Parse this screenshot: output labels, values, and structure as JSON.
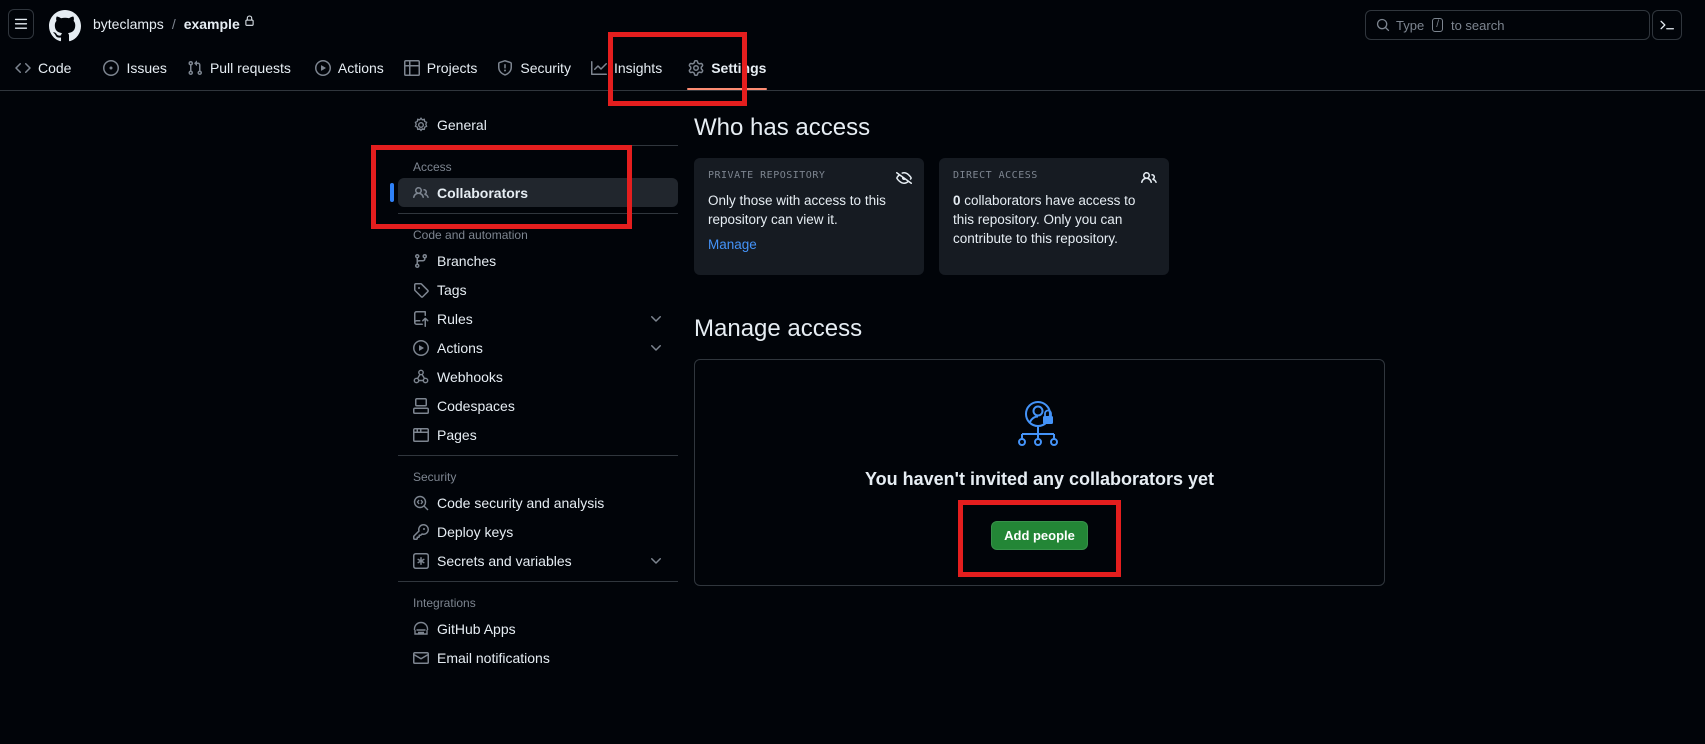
{
  "header": {
    "owner": "byteclamps",
    "separator": "/",
    "repo": "example",
    "search_prefix": "Type",
    "search_key": "/",
    "search_suffix": "to search"
  },
  "tabs": [
    {
      "label": "Code",
      "icon": "code-icon"
    },
    {
      "label": "Issues",
      "icon": "issue-opened-icon"
    },
    {
      "label": "Pull requests",
      "icon": "git-pull-request-icon"
    },
    {
      "label": "Actions",
      "icon": "play-icon"
    },
    {
      "label": "Projects",
      "icon": "table-icon"
    },
    {
      "label": "Security",
      "icon": "shield-icon"
    },
    {
      "label": "Insights",
      "icon": "graph-icon"
    },
    {
      "label": "Settings",
      "icon": "gear-icon",
      "active": true
    }
  ],
  "sidebar": {
    "general": "General",
    "access_heading": "Access",
    "collaborators": "Collaborators",
    "code_heading": "Code and automation",
    "branches": "Branches",
    "tags": "Tags",
    "rules": "Rules",
    "actions": "Actions",
    "webhooks": "Webhooks",
    "codespaces": "Codespaces",
    "pages": "Pages",
    "security_heading": "Security",
    "code_security": "Code security and analysis",
    "deploy_keys": "Deploy keys",
    "secrets": "Secrets and variables",
    "integrations_heading": "Integrations",
    "github_apps": "GitHub Apps",
    "email_notifications": "Email notifications"
  },
  "main": {
    "who_title": "Who has access",
    "private_card": {
      "label": "PRIVATE REPOSITORY",
      "body": "Only those with access to this repository can view it.",
      "link": "Manage"
    },
    "direct_card": {
      "label": "DIRECT ACCESS",
      "count": "0",
      "body": " collaborators have access to this repository. Only you can contribute to this repository."
    },
    "manage_title": "Manage access",
    "empty_title": "You haven't invited any collaborators yet",
    "add_button": "Add people"
  },
  "colors": {
    "background": "#010409",
    "accent_link": "#4493f8",
    "primary_button": "#238636",
    "active_tab_underline": "#fd8c73",
    "highlight_box": "#e41e1e"
  }
}
